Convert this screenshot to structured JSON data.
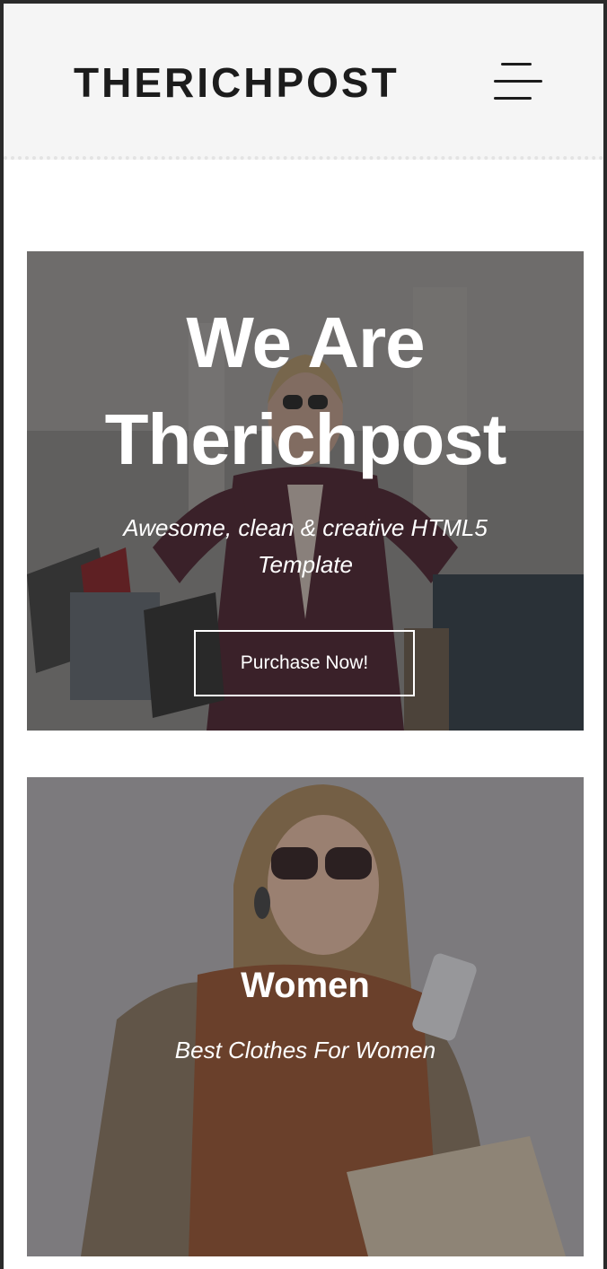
{
  "header": {
    "logo": "THERICHPOST",
    "menu_icon": "hamburger-menu-icon"
  },
  "hero": {
    "title_line1": "We Are",
    "title_line2": "Therichpost",
    "subtitle": "Awesome, clean & creative HTML5 Template",
    "button_label": "Purchase Now!"
  },
  "category": {
    "title": "Women",
    "subtitle": "Best Clothes For Women"
  },
  "colors": {
    "text_dark": "#1c1c1c",
    "header_bg": "#f5f5f5",
    "overlay": "#3a3a3a",
    "white": "#ffffff"
  }
}
